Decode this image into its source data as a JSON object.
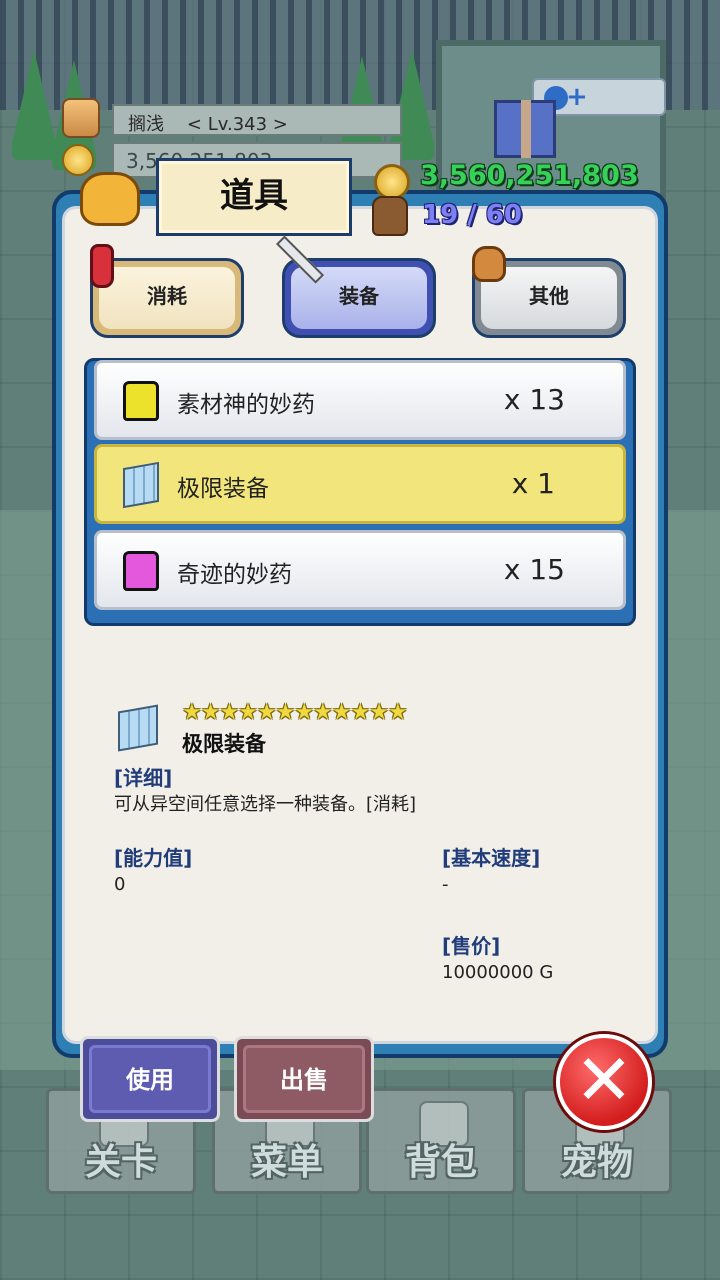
{
  "player": {
    "name": "搁浅",
    "level": "< Lv.343 >",
    "gold_partial": "3,560,251,803"
  },
  "header": {
    "title": "道具",
    "gold": "3,560,251,803",
    "capacity": "19 / 60"
  },
  "tabs": [
    {
      "label": "消耗",
      "icon": "potion-icon"
    },
    {
      "label": "装备",
      "icon": "sword-icon",
      "active": true
    },
    {
      "label": "其他",
      "icon": "sack-icon"
    }
  ],
  "items": [
    {
      "name": "素材神的妙药",
      "qty": "x 13",
      "icon": "yellow-potion-icon"
    },
    {
      "name": "极限装备",
      "qty": "x 1",
      "icon": "cube-icon",
      "selected": true
    },
    {
      "name": "奇迹的妙药",
      "qty": "x 15",
      "icon": "pink-potion-icon"
    }
  ],
  "detail": {
    "stars": "★★★★★★★★★★★★",
    "name": "极限装备",
    "detail_label": "[详细]",
    "description": "可从异空间任意选择一种装备。[消耗]",
    "ability_label": "[能力值]",
    "ability_value": "0",
    "speed_label": "[基本速度]",
    "speed_value": "-",
    "price_label": "[售价]",
    "price_value": "10000000 G"
  },
  "actions": {
    "use": "使用",
    "sell": "出售"
  },
  "bottom_nav": [
    "关卡",
    "菜单",
    "背包",
    "宠物"
  ],
  "colors": {
    "panel_blue": "#2e7fb4",
    "selected_row": "#f1e57b",
    "gold_text": "#37d159",
    "capacity_text": "#7f7ff5",
    "close_red": "#d41e1e"
  }
}
